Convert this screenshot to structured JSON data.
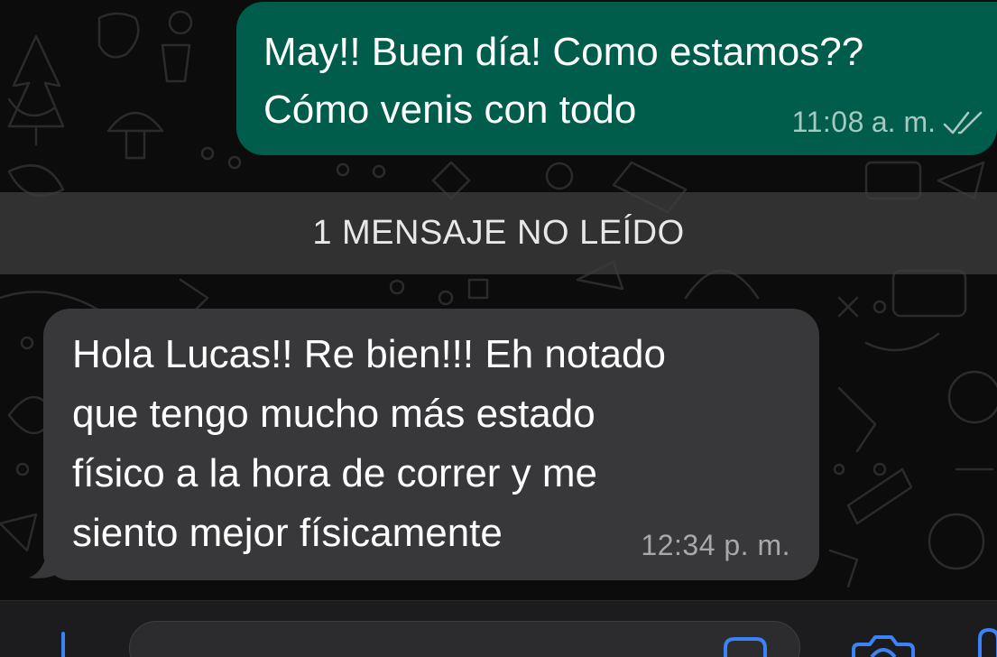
{
  "chat": {
    "messages": [
      {
        "direction": "outgoing",
        "lines": [
          "May!! Buen día! Como estamos??",
          "Cómo venis con todo"
        ],
        "time": "11:08",
        "period": "a. m.",
        "status_icon": "double-check-icon"
      },
      {
        "direction": "incoming",
        "lines": [
          "Hola Lucas!! Re bien!!! Eh notado",
          "que tengo mucho más estado",
          "físico a la hora de correr y me",
          "siento mejor físicamente"
        ],
        "time": "12:34",
        "period": "p. m."
      }
    ],
    "unread_banner": "1 MENSAJE NO LEÍDO"
  },
  "composer": {
    "placeholder": "",
    "icons": [
      "plus-icon",
      "sticker-icon",
      "camera-icon",
      "mic-icon"
    ]
  },
  "colors": {
    "outgoing_bubble": "#005c4b",
    "incoming_bubble": "#38383a",
    "background": "#0c0c0c",
    "accent": "#3b82f6"
  }
}
